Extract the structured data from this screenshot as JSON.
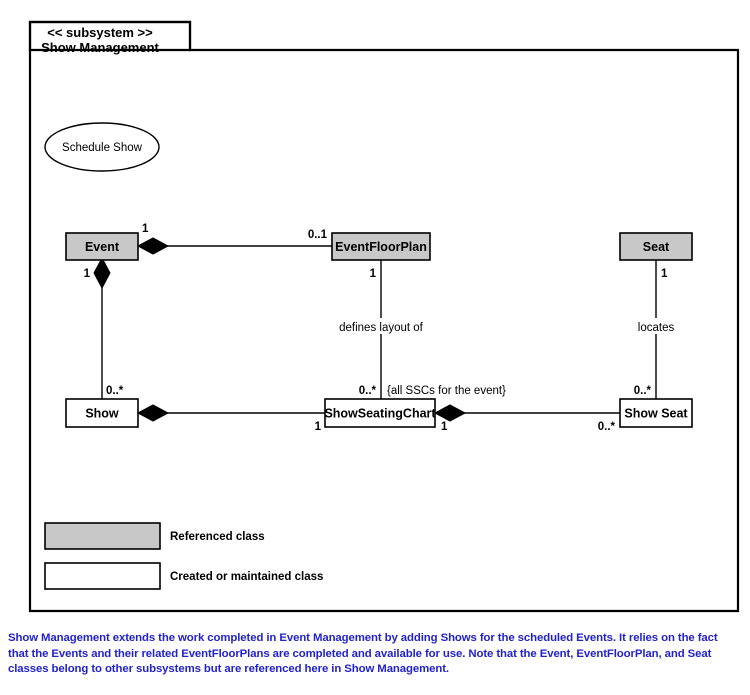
{
  "frame": {
    "subsystem_stereotype": "<< subsystem >>",
    "subsystem_name": "Show Management"
  },
  "use_case": {
    "label": "Schedule Show"
  },
  "classes": [
    {
      "id": "event",
      "label": "Event",
      "kind": "referenced"
    },
    {
      "id": "eventfloorplan",
      "label": "EventFloorPlan",
      "kind": "referenced"
    },
    {
      "id": "seat",
      "label": "Seat",
      "kind": "referenced"
    },
    {
      "id": "show",
      "label": "Show",
      "kind": "created"
    },
    {
      "id": "showseatingchart",
      "label": "ShowSeatingChart",
      "kind": "created"
    },
    {
      "id": "showseat",
      "label": "Show Seat",
      "kind": "created"
    }
  ],
  "associations": [
    {
      "id": "event-eventfloorplan",
      "from": "event",
      "to": "eventfloorplan",
      "from_multiplicity": "1",
      "to_multiplicity": "0..1",
      "label": "",
      "aggregation_at": "from"
    },
    {
      "id": "event-show",
      "from": "event",
      "to": "show",
      "from_multiplicity": "1",
      "to_multiplicity": "0..*",
      "label": "",
      "aggregation_at": "from"
    },
    {
      "id": "eventfloorplan-showseatingchart",
      "from": "eventfloorplan",
      "to": "showseatingchart",
      "from_multiplicity": "1",
      "to_multiplicity": "0..*",
      "label": "defines layout of",
      "constraint": "{all SSCs for the event}",
      "aggregation_at": "none"
    },
    {
      "id": "show-showseatingchart",
      "from": "show",
      "to": "showseatingchart",
      "from_multiplicity": "",
      "to_multiplicity": "1",
      "label": "",
      "aggregation_at": "from"
    },
    {
      "id": "showseatingchart-showseat",
      "from": "showseatingchart",
      "to": "showseat",
      "from_multiplicity": "1",
      "to_multiplicity": "0..*",
      "label": "",
      "aggregation_at": "from"
    },
    {
      "id": "seat-showseat",
      "from": "seat",
      "to": "showseat",
      "from_multiplicity": "1",
      "to_multiplicity": "0..*",
      "label": "locates",
      "aggregation_at": "none"
    }
  ],
  "multiplicity_labels": {
    "event_right": "1",
    "eventfloorplan_left": "0..1",
    "event_bottom": "1",
    "show_top": "0..*",
    "eventfloorplan_bottom": "1",
    "showseatingchart_top": "0..*",
    "showseatingchart_left": "1",
    "showseatingchart_right": "1",
    "showseat_left": "0..*",
    "showseat_top": "0..*",
    "seat_bottom": "1"
  },
  "association_labels": {
    "defines_layout_of": "defines layout of",
    "locates": "locates",
    "ssc_constraint": "{all SSCs for the event}"
  },
  "legend": [
    {
      "id": "referenced",
      "swatch": "referenced",
      "label": "Referenced class"
    },
    {
      "id": "created",
      "swatch": "created",
      "label": "Created or maintained class"
    }
  ],
  "caption": {
    "text": "Show Management extends the work completed in Event Management by adding Shows for the scheduled Events.  It relies on the fact that the Events and their related EventFloorPlans are completed and available for use.  Note that the Event, EventFloorPlan, and Seat classes belong to other subsystems but are referenced here in Show Management."
  },
  "colors": {
    "referenced_fill": "#c8c8c8",
    "created_fill": "#ffffff",
    "stroke": "#000000",
    "caption_text": "#2222cc"
  }
}
